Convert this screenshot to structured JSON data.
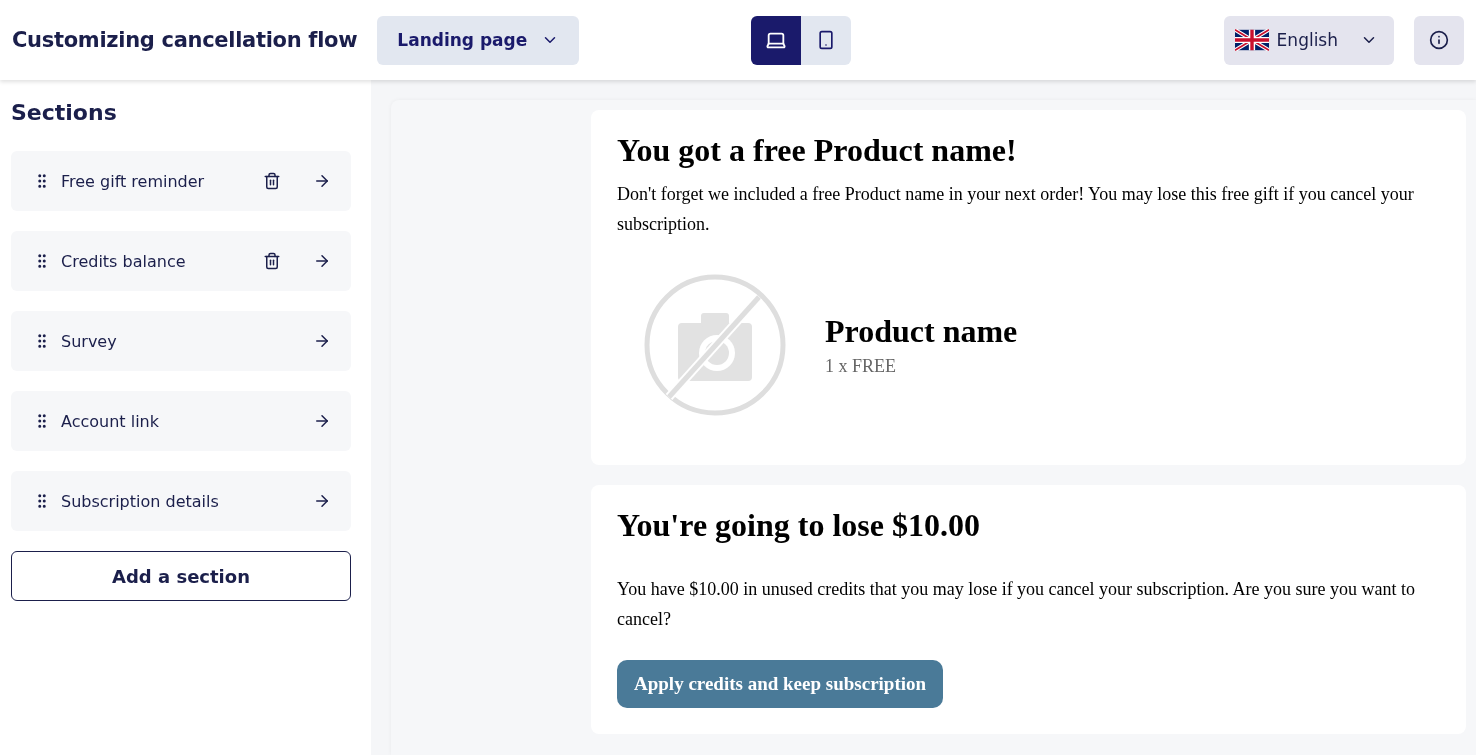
{
  "header": {
    "title": "Customizing cancellation flow",
    "page_select": "Landing page",
    "devices": [
      {
        "kind": "desktop",
        "selected": true
      },
      {
        "kind": "mobile",
        "selected": false
      }
    ],
    "language": "English"
  },
  "sidebar": {
    "title": "Sections",
    "items": [
      {
        "label": "Free gift reminder",
        "deletable": true
      },
      {
        "label": "Credits balance",
        "deletable": true
      },
      {
        "label": "Survey",
        "deletable": false
      },
      {
        "label": "Account link",
        "deletable": false
      },
      {
        "label": "Subscription details",
        "deletable": false
      }
    ],
    "add_button": "Add a section"
  },
  "preview": {
    "cards": [
      {
        "kind": "gift",
        "title": "You got a free Product name!",
        "body": "Don't forget we included a free Product name in your next order! You may lose this free gift if you cancel your subscription.",
        "product": {
          "name": "Product name",
          "quantity": "1 x FREE"
        }
      },
      {
        "kind": "credits",
        "title": "You're going to lose $10.00",
        "body": "You have $10.00 in unused credits that you may lose if you cancel your subscription. Are you sure you want to cancel?",
        "button": "Apply credits and keep subscription"
      }
    ]
  }
}
